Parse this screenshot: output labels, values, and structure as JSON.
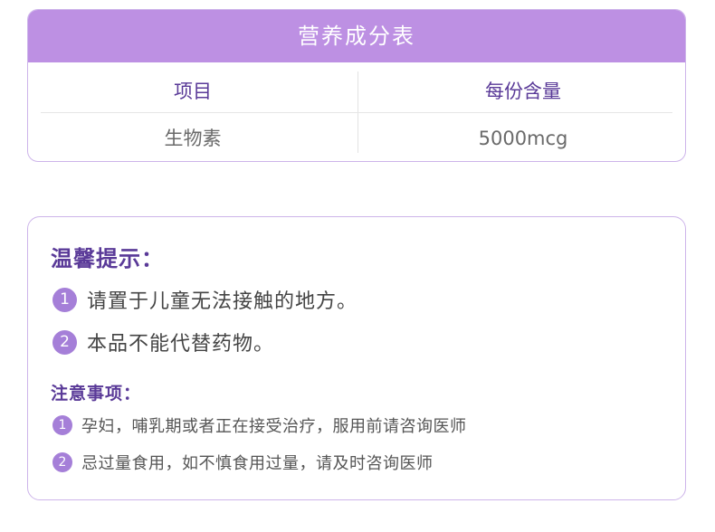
{
  "nutrition": {
    "title": "营养成分表",
    "headers": [
      "项目",
      "每份含量"
    ],
    "rows": [
      [
        "生物素",
        "5000mcg"
      ]
    ]
  },
  "tips": {
    "title": "温馨提示：",
    "items": [
      {
        "num": "1",
        "text": "请置于儿童无法接触的地方。"
      },
      {
        "num": "2",
        "text": "本品不能代替药物。"
      }
    ]
  },
  "notes": {
    "title": "注意事项：",
    "items": [
      {
        "num": "1",
        "text": "孕妇，哺乳期或者正在接受治疗，服用前请咨询医师"
      },
      {
        "num": "2",
        "text": "忌过量食用，如不慎食用过量，请及时咨询医师"
      }
    ]
  },
  "colors": {
    "accent": "#bd90e3",
    "title_text": "#5a3a98",
    "badge": "#a57fd8",
    "border": "#cdb4ea"
  }
}
